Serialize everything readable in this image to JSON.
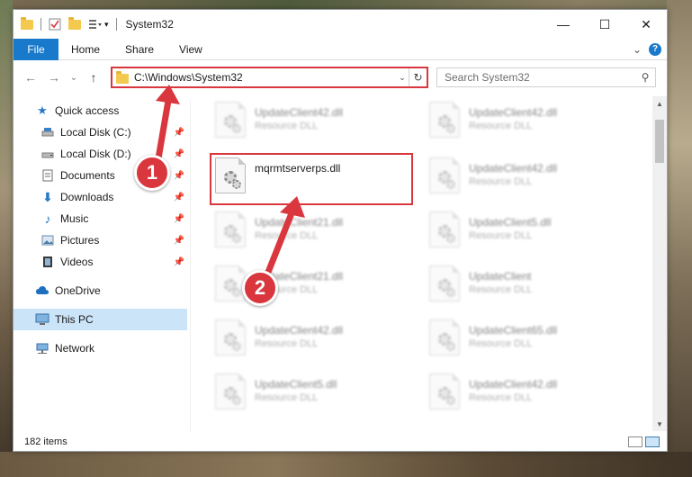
{
  "window": {
    "title": "System32",
    "minimize": "—",
    "maximize": "☐",
    "close": "✕"
  },
  "ribbon": {
    "tabs": [
      "File",
      "Home",
      "Share",
      "View"
    ],
    "expand": "⌄",
    "help": "?"
  },
  "address": {
    "path": "C:\\Windows\\System32",
    "dropdown": "⌄",
    "refresh": "↻"
  },
  "search": {
    "placeholder": "Search System32"
  },
  "nav": {
    "back": "←",
    "forward": "→",
    "recent": "⌄",
    "up": "↑"
  },
  "sidebar": {
    "items": [
      {
        "label": "Quick access",
        "icon": "star-icon",
        "pinned": false
      },
      {
        "label": "Local Disk (C:)",
        "icon": "drive-icon",
        "pinned": true
      },
      {
        "label": "Local Disk (D:)",
        "icon": "drive-icon",
        "pinned": true
      },
      {
        "label": "Documents",
        "icon": "document-icon",
        "pinned": true
      },
      {
        "label": "Downloads",
        "icon": "download-icon",
        "pinned": true
      },
      {
        "label": "Music",
        "icon": "music-icon",
        "pinned": true
      },
      {
        "label": "Pictures",
        "icon": "picture-icon",
        "pinned": true
      },
      {
        "label": "Videos",
        "icon": "video-icon",
        "pinned": true
      },
      {
        "label": "OneDrive",
        "icon": "cloud-icon",
        "pinned": false
      },
      {
        "label": "This PC",
        "icon": "computer-icon",
        "pinned": false
      },
      {
        "label": "Network",
        "icon": "network-icon",
        "pinned": false
      }
    ]
  },
  "files": {
    "left_column": [
      {
        "name": "UpdateClient42.dll",
        "type": "Resource DLL"
      },
      {
        "name": "mqrmtserverps.dll",
        "type": ""
      },
      {
        "name": "UpdateClient21.dll",
        "type": "Resource DLL"
      },
      {
        "name": "UpdateClient21.dll",
        "type": "Resource DLL"
      },
      {
        "name": "UpdateClient42.dll",
        "type": "Resource DLL"
      },
      {
        "name": "UpdateClient5.dll",
        "type": "Resource DLL"
      }
    ],
    "right_column": [
      {
        "name": "UpdateClient42.dll",
        "type": "Resource DLL"
      },
      {
        "name": "UpdateClient42.dll",
        "type": "Resource DLL"
      },
      {
        "name": "UpdateClient5.dll",
        "type": "Resource DLL"
      },
      {
        "name": "UpdateClient",
        "type": "Resource DLL"
      },
      {
        "name": "UpdateClient65.dll",
        "type": "Resource DLL"
      },
      {
        "name": "UpdateClient42.dll",
        "type": "Resource DLL"
      }
    ]
  },
  "status": {
    "count": "182 items"
  },
  "annotations": {
    "step1": "1",
    "step2": "2"
  },
  "colors": {
    "accent": "#1979ca",
    "highlight_red": "#d9363e",
    "selected": "#cce4f7"
  }
}
